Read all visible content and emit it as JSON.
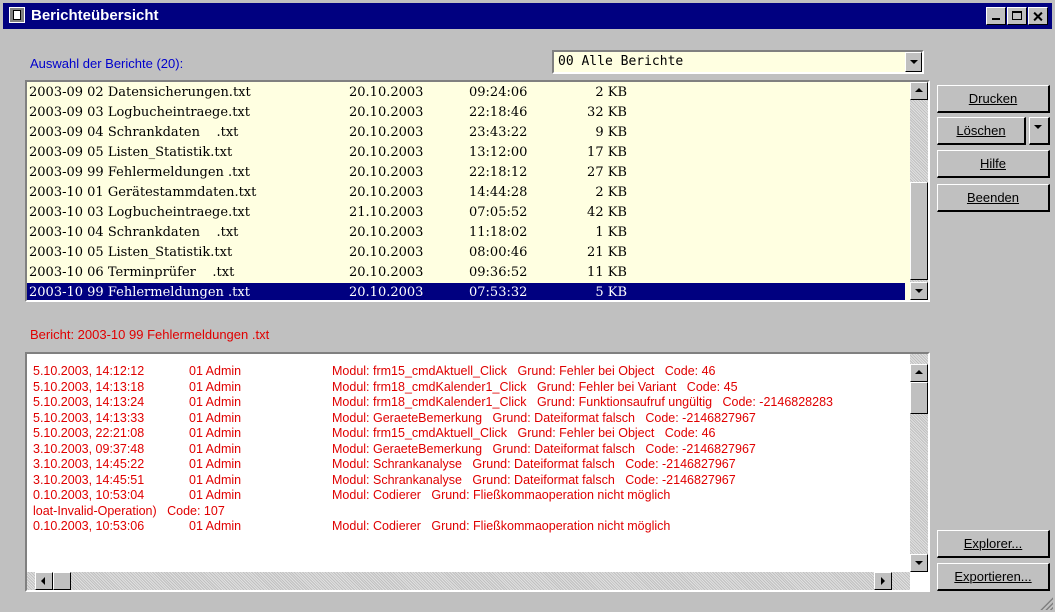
{
  "window": {
    "title": "Berichteübersicht"
  },
  "selection": {
    "label": "Auswahl der Berichte (20):",
    "combo_value": "00 Alle Berichte"
  },
  "reports": [
    {
      "name": "2003-09 02 Datensicherungen.txt",
      "date": "20.10.2003",
      "time": "09:24:06",
      "size": "2 KB"
    },
    {
      "name": "2003-09 03 Logbucheintraege.txt",
      "date": "20.10.2003",
      "time": "22:18:46",
      "size": "32 KB"
    },
    {
      "name": "2003-09 04 Schrankdaten    .txt",
      "date": "20.10.2003",
      "time": "23:43:22",
      "size": "9 KB"
    },
    {
      "name": "2003-09 05 Listen_Statistik.txt",
      "date": "20.10.2003",
      "time": "13:12:00",
      "size": "17 KB"
    },
    {
      "name": "2003-09 99 Fehlermeldungen .txt",
      "date": "20.10.2003",
      "time": "22:18:12",
      "size": "27 KB"
    },
    {
      "name": "2003-10 01 Gerätestammdaten.txt",
      "date": "20.10.2003",
      "time": "14:44:28",
      "size": "2 KB"
    },
    {
      "name": "2003-10 03 Logbucheintraege.txt",
      "date": "21.10.2003",
      "time": "07:05:52",
      "size": "42 KB"
    },
    {
      "name": "2003-10 04 Schrankdaten    .txt",
      "date": "20.10.2003",
      "time": "11:18:02",
      "size": "1 KB"
    },
    {
      "name": "2003-10 05 Listen_Statistik.txt",
      "date": "20.10.2003",
      "time": "08:00:46",
      "size": "21 KB"
    },
    {
      "name": "2003-10 06 Terminprüfer    .txt",
      "date": "20.10.2003",
      "time": "09:36:52",
      "size": "11 KB"
    },
    {
      "name": "2003-10 99 Fehlermeldungen .txt",
      "date": "20.10.2003",
      "time": "07:53:32",
      "size": "5 KB"
    }
  ],
  "selected_report_index": 10,
  "report": {
    "label": "Bericht: 2003-10 99 Fehlermeldungen .txt"
  },
  "log": [
    {
      "ts": "5.10.2003, 14:12:12",
      "user": "01 Admin",
      "msg": "Modul: frm15_cmdAktuell_Click   Grund: Fehler bei Object   Code: 46"
    },
    {
      "ts": "5.10.2003, 14:13:18",
      "user": "01 Admin",
      "msg": "Modul: frm18_cmdKalender1_Click   Grund: Fehler bei Variant   Code: 45"
    },
    {
      "ts": "5.10.2003, 14:13:24",
      "user": "01 Admin",
      "msg": "Modul: frm18_cmdKalender1_Click   Grund: Funktionsaufruf ungültig   Code: -2146828283"
    },
    {
      "ts": "5.10.2003, 14:13:33",
      "user": "01 Admin",
      "msg": "Modul: GeraeteBemerkung   Grund: Dateiformat falsch   Code: -2146827967"
    },
    {
      "ts": "5.10.2003, 22:21:08",
      "user": "01 Admin",
      "msg": "Modul: frm15_cmdAktuell_Click   Grund: Fehler bei Object   Code: 46"
    },
    {
      "ts": "3.10.2003, 09:37:48",
      "user": "01 Admin",
      "msg": "Modul: GeraeteBemerkung   Grund: Dateiformat falsch   Code: -2146827967"
    },
    {
      "ts": "3.10.2003, 14:45:22",
      "user": "01 Admin",
      "msg": "Modul: Schrankanalyse   Grund: Dateiformat falsch   Code: -2146827967"
    },
    {
      "ts": "3.10.2003, 14:45:51",
      "user": "01 Admin",
      "msg": "Modul: Schrankanalyse   Grund: Dateiformat falsch   Code: -2146827967"
    },
    {
      "ts": "0.10.2003, 10:53:04",
      "user": "01 Admin",
      "msg": "Modul: Codierer   Grund: Fließkommaoperation nicht möglich"
    },
    {
      "ts": "loat-Invalid-Operation)   Code: 107",
      "user": "",
      "msg": ""
    },
    {
      "ts": "0.10.2003, 10:53:06",
      "user": "01 Admin",
      "msg": "Modul: Codierer   Grund: Fließkommaoperation nicht möglich"
    }
  ],
  "buttons": {
    "print": "Drucken",
    "delete": "Löschen",
    "help": "Hilfe",
    "exit": "Beenden",
    "explorer": "Explorer...",
    "export": "Exportieren..."
  },
  "colors": {
    "titlebar": "#000080",
    "list_background": "#ffffe1",
    "selection": "#000080",
    "label_blue": "#0000cc",
    "error_red": "#e00000"
  }
}
